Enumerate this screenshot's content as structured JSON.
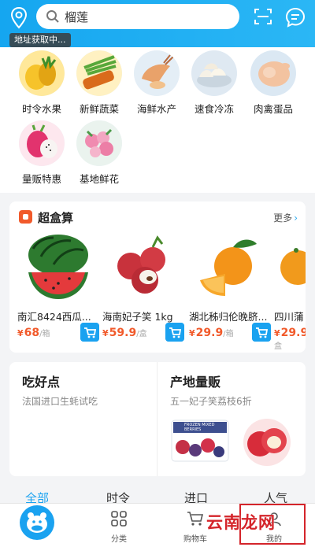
{
  "header": {
    "search_text": "榴莲",
    "address_tip": "地址获取中..."
  },
  "categories": [
    {
      "label": "时令水果",
      "icon": "fruit"
    },
    {
      "label": "新鲜蔬菜",
      "icon": "vegetables"
    },
    {
      "label": "海鲜水产",
      "icon": "seafood"
    },
    {
      "label": "速食冷冻",
      "icon": "frozen-food"
    },
    {
      "label": "肉禽蛋品",
      "icon": "meat"
    },
    {
      "label": "量贩特惠",
      "icon": "bulk-deal"
    },
    {
      "label": "基地鲜花",
      "icon": "flowers"
    }
  ],
  "box_deal": {
    "title": "超盒算",
    "more": "更多",
    "products": [
      {
        "name": "南汇8424西瓜...",
        "currency": "¥",
        "price": "68",
        "unit": "/箱"
      },
      {
        "name": "海南妃子笑 1kg",
        "currency": "¥",
        "price": "59.9",
        "unit": "/盒"
      },
      {
        "name": "湖北秭归伦晚脐...",
        "currency": "¥",
        "price": "29.9",
        "unit": "/箱"
      },
      {
        "name": "四川蒲",
        "currency": "¥",
        "price": "29.9",
        "unit": "/盒"
      }
    ]
  },
  "promo": {
    "left_title": "吃好点",
    "left_sub": "法国进口生蚝试吃",
    "right_title": "产地量贩",
    "right_sub": "五一妃子笑荔枝6折",
    "package_text": "FROZEN MIXED BERRIES"
  },
  "filter_tabs": [
    "全部",
    "时令",
    "进口",
    "人气"
  ],
  "bottom_nav": {
    "items": [
      {
        "label": "分类"
      },
      {
        "label": "购物车"
      },
      {
        "label": "我的"
      }
    ]
  },
  "watermark": "云南龙网",
  "colors": {
    "accent": "#1aa2f0",
    "price": "#f15a2b",
    "watermark": "#d4242a"
  }
}
